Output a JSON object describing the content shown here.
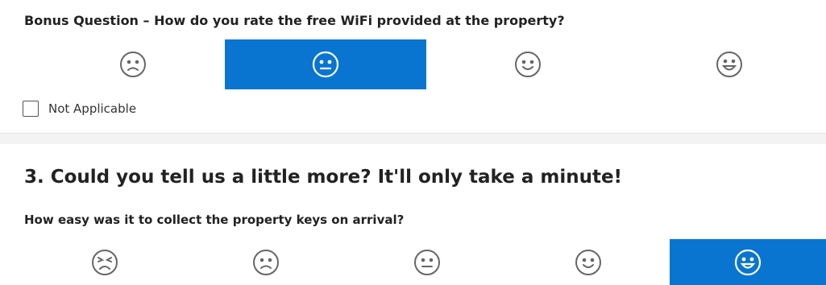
{
  "bonus_question": {
    "text": "Bonus Question – How do you rate the free WiFi provided at the property?",
    "options": [
      {
        "icon": "sad-face-icon",
        "selected": false
      },
      {
        "icon": "neutral-face-icon",
        "selected": true
      },
      {
        "icon": "smile-face-icon",
        "selected": false
      },
      {
        "icon": "big-smile-face-icon",
        "selected": false
      }
    ],
    "not_applicable_label": "Not Applicable",
    "not_applicable_checked": false
  },
  "section3": {
    "title": "3. Could you tell us a little more? It'll only take a minute!",
    "keys_question": {
      "text": "How easy was it to collect the property keys on arrival?",
      "options": [
        {
          "icon": "angry-face-icon",
          "selected": false
        },
        {
          "icon": "sad-face-icon",
          "selected": false
        },
        {
          "icon": "neutral-face-icon",
          "selected": false
        },
        {
          "icon": "smile-face-icon",
          "selected": false
        },
        {
          "icon": "big-smile-face-icon",
          "selected": true
        }
      ]
    }
  },
  "colors": {
    "accent": "#0a75d0",
    "divider_band": "#f3f3f3"
  }
}
